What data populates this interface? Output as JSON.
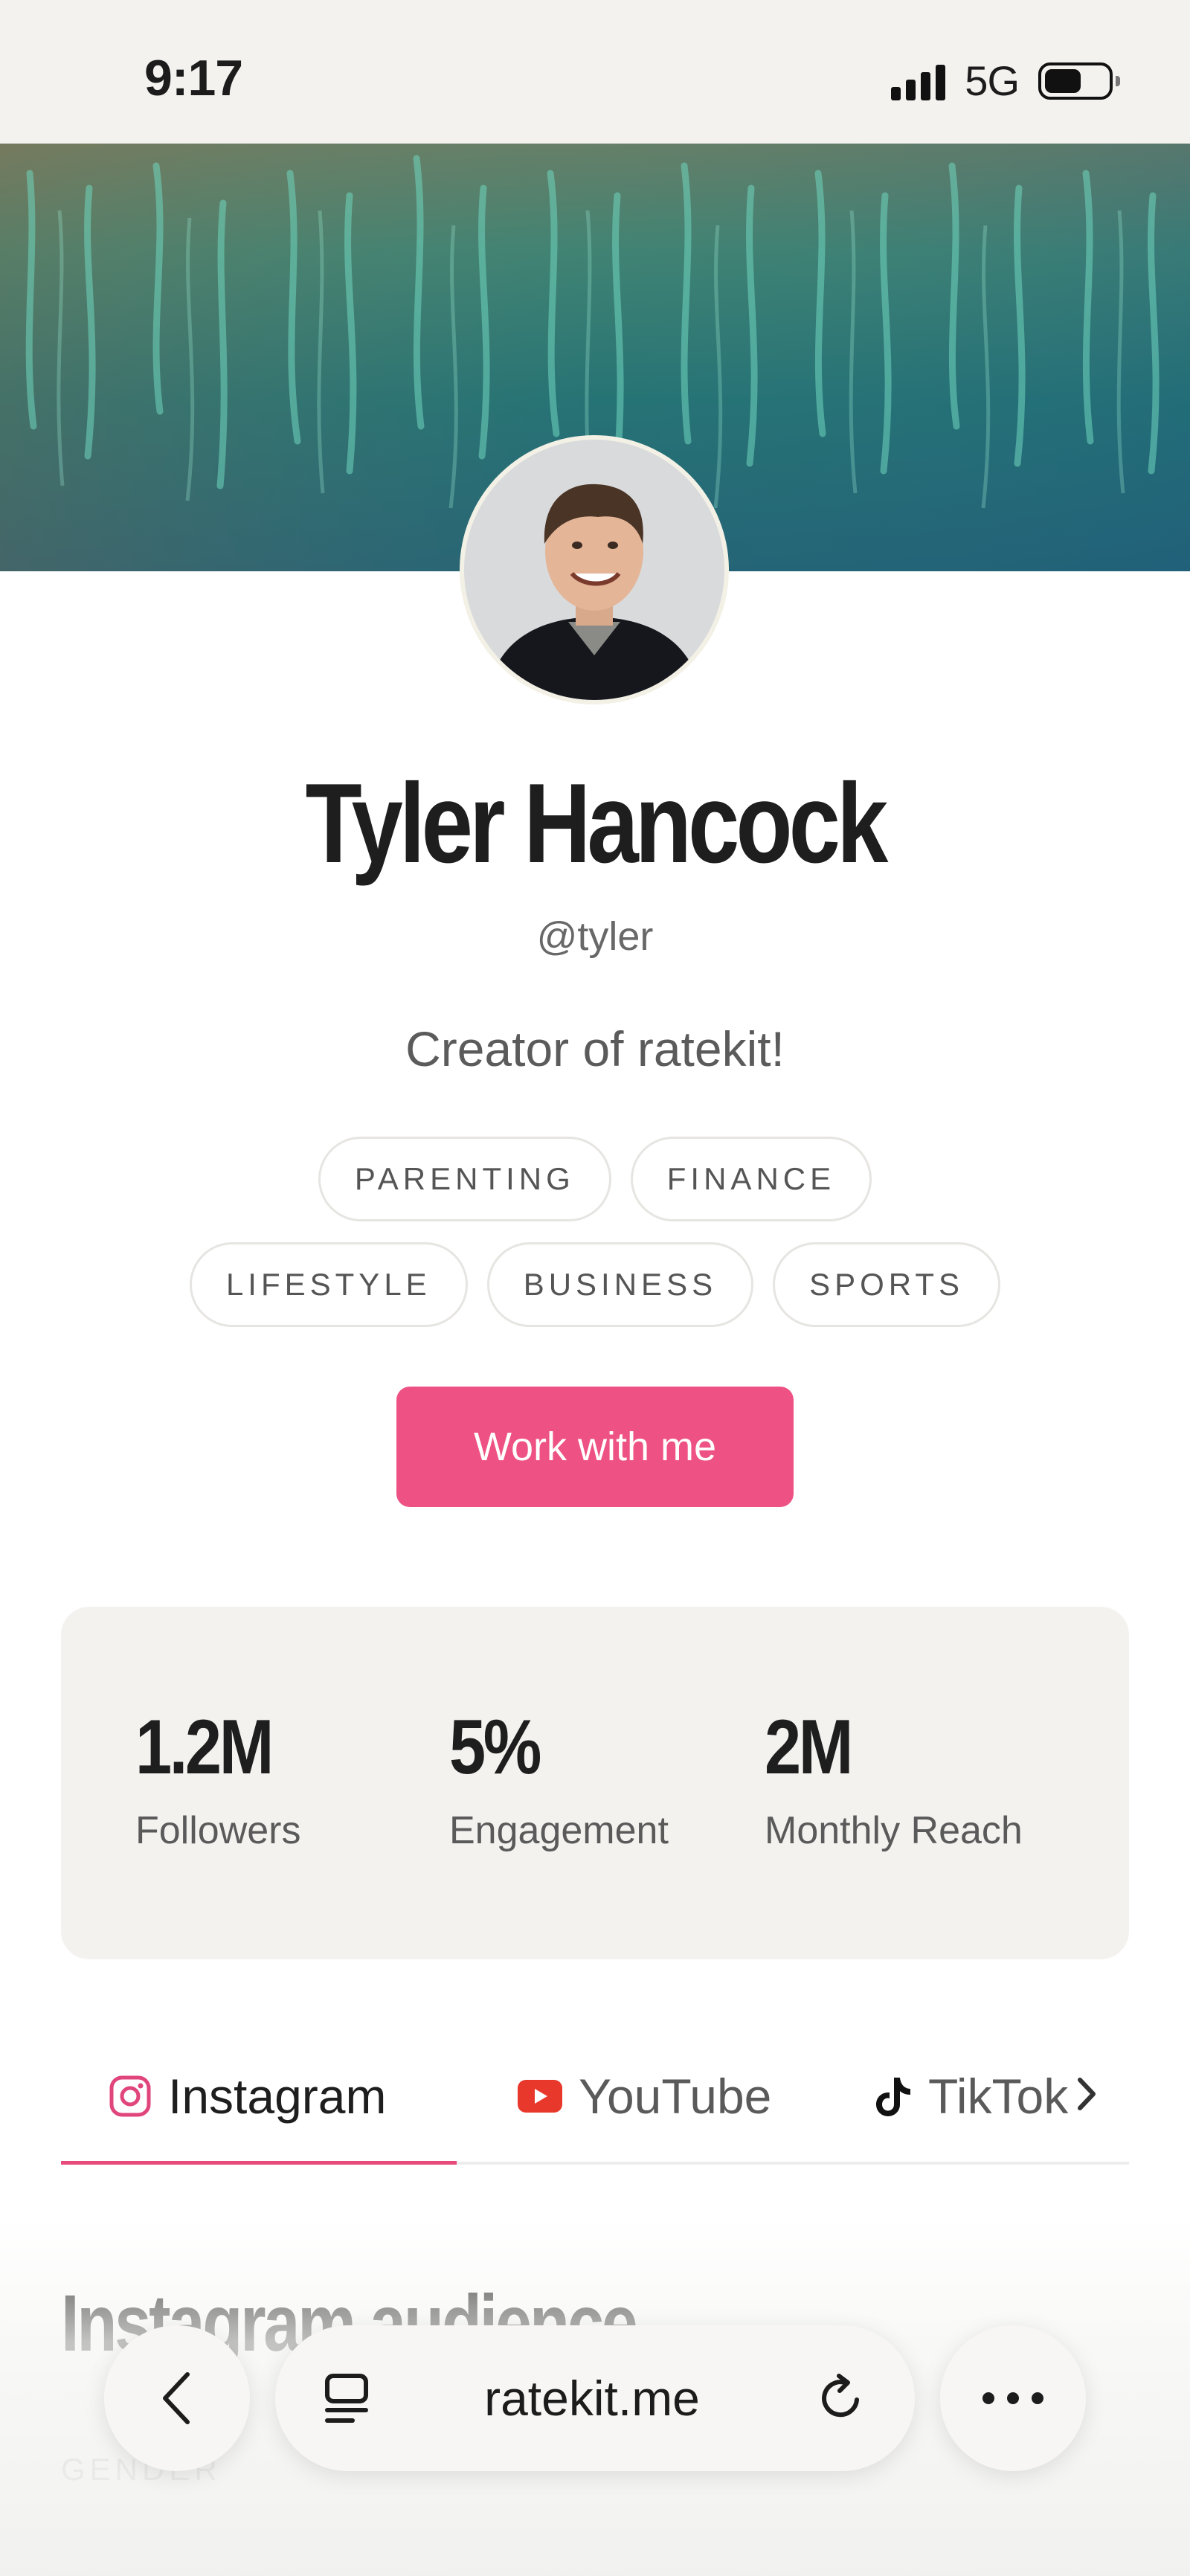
{
  "status_bar": {
    "time": "9:17",
    "network": "5G"
  },
  "profile": {
    "name": "Tyler Hancock",
    "handle": "@tyler",
    "bio": "Creator of ratekit!",
    "tags": [
      "PARENTING",
      "FINANCE",
      "LIFESTYLE",
      "BUSINESS",
      "SPORTS"
    ],
    "cta_label": "Work with me"
  },
  "stats": [
    {
      "value": "1.2M",
      "label": "Followers"
    },
    {
      "value": "5%",
      "label": "Engagement"
    },
    {
      "value": "2M",
      "label": "Monthly Reach"
    }
  ],
  "tabs": [
    {
      "label": "Instagram",
      "icon": "instagram-icon",
      "active": true
    },
    {
      "label": "YouTube",
      "icon": "youtube-icon",
      "active": false
    },
    {
      "label": "TikTok",
      "icon": "tiktok-icon",
      "active": false
    }
  ],
  "section": {
    "title": "Instagram audience",
    "subtitle": "GENDER"
  },
  "browser": {
    "address": "ratekit.me"
  },
  "colors": {
    "accent": "#ee5183",
    "tab_underline": "#e64b7a",
    "card_bg": "#f3f2ef"
  }
}
